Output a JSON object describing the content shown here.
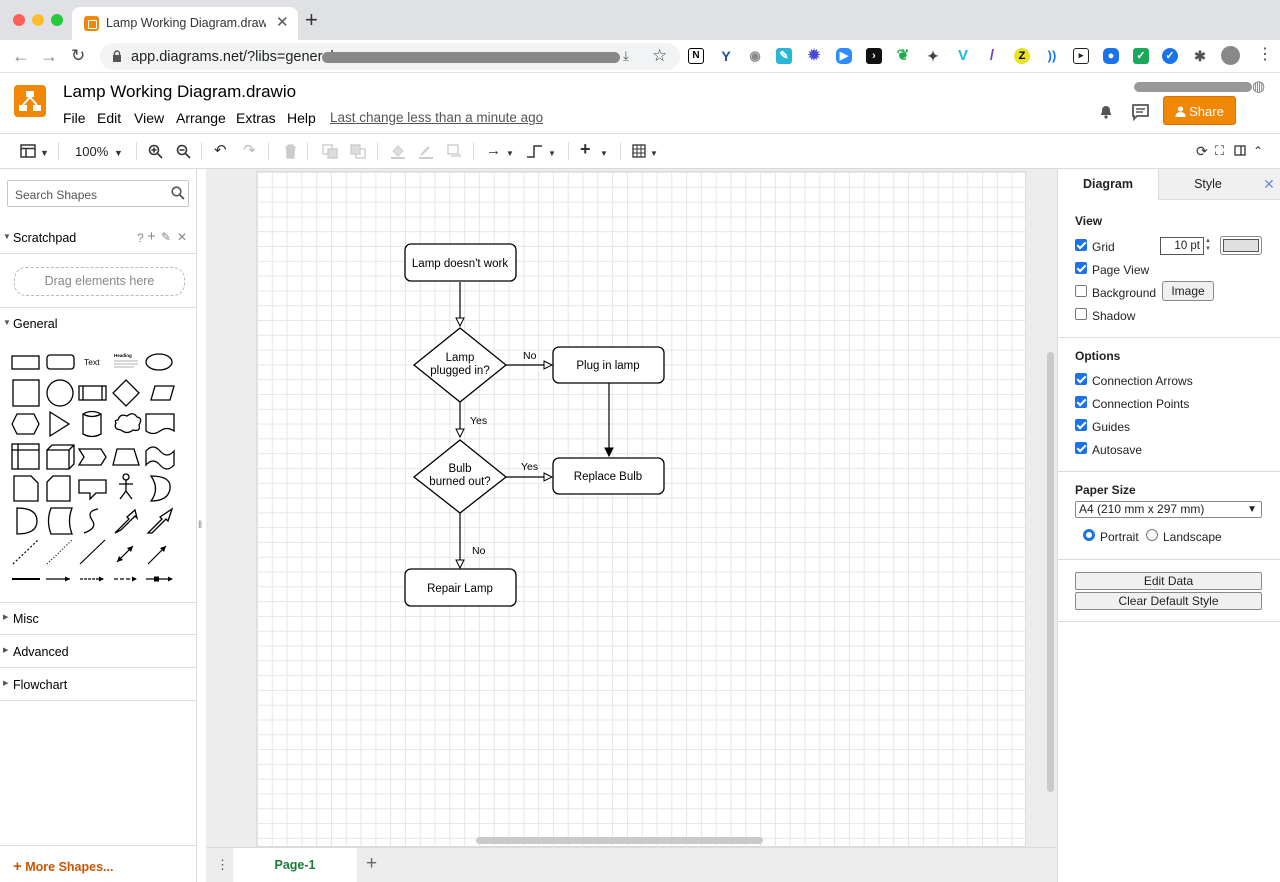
{
  "browser": {
    "tab_title": "Lamp Working Diagram.drawio",
    "url": "app.diagrams.net/?libs=general;"
  },
  "app": {
    "file_title": "Lamp Working Diagram.drawio",
    "menu": [
      "File",
      "Edit",
      "View",
      "Arrange",
      "Extras",
      "Help"
    ],
    "last_change": "Last change less than a minute ago",
    "share_label": "Share",
    "brand_color": "#f08705"
  },
  "toolbar": {
    "zoom": "100%"
  },
  "sidebar": {
    "search_placeholder": "Search Shapes",
    "scratchpad": "Scratchpad",
    "scratchpad_help": "?",
    "drag_hint": "Drag elements here",
    "general": "General",
    "text_shape": "Text",
    "heading_shape": "Heading",
    "sections": [
      "Misc",
      "Advanced",
      "Flowchart"
    ],
    "more_shapes": "More Shapes..."
  },
  "pages": {
    "current": "Page-1"
  },
  "format_panel": {
    "tab_diagram": "Diagram",
    "tab_style": "Style",
    "view_title": "View",
    "grid_label": "Grid",
    "grid_checked": true,
    "grid_size": "10 pt",
    "page_view_label": "Page View",
    "page_view_checked": true,
    "background_label": "Background",
    "background_checked": false,
    "image_button": "Image",
    "shadow_label": "Shadow",
    "shadow_checked": false,
    "options_title": "Options",
    "connection_arrows": "Connection Arrows",
    "connection_points": "Connection Points",
    "guides": "Guides",
    "autosave": "Autosave",
    "paper_size_title": "Paper Size",
    "paper_size": "A4 (210 mm x 297 mm)",
    "portrait": "Portrait",
    "landscape": "Landscape",
    "orientation": "Portrait",
    "edit_data": "Edit Data",
    "clear_default_style": "Clear Default Style"
  },
  "diagram": {
    "nodes": {
      "start": "Lamp doesn't work",
      "plugged_line1": "Lamp",
      "plugged_line2": "plugged in?",
      "plug": "Plug in lamp",
      "burned_line1": "Bulb",
      "burned_line2": "burned out?",
      "replace": "Replace Bulb",
      "repair": "Repair Lamp"
    },
    "edge_labels": {
      "plugged_no": "No",
      "plugged_yes": "Yes",
      "burned_yes": "Yes",
      "burned_no": "No"
    }
  }
}
